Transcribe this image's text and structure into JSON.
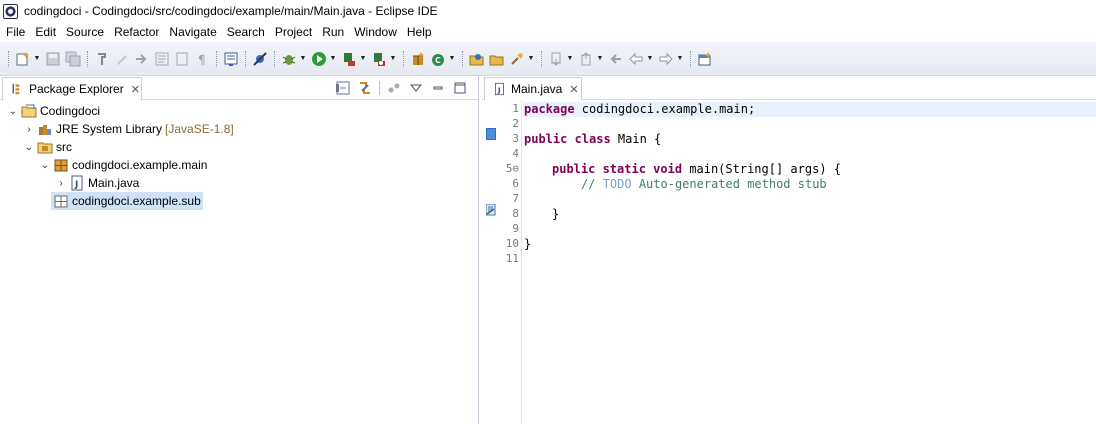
{
  "window": {
    "title": "codingdoci - Codingdoci/src/codingdoci/example/main/Main.java - Eclipse IDE"
  },
  "menu": [
    "File",
    "Edit",
    "Source",
    "Refactor",
    "Navigate",
    "Search",
    "Project",
    "Run",
    "Window",
    "Help"
  ],
  "package_explorer": {
    "tab_label": "Package Explorer",
    "tab_close": "✕",
    "tree": {
      "project": "Codingdoci",
      "jre": "JRE System Library",
      "jre_decor": "[JavaSE-1.8]",
      "src": "src",
      "pkg_main": "codingdoci.example.main",
      "file_main": "Main.java",
      "pkg_sub": "codingdoci.example.sub"
    }
  },
  "editor": {
    "tab_label": "Main.java",
    "tab_close": "✕",
    "line_numbers": [
      "1",
      "2",
      "3",
      "4",
      "5⊖",
      "6",
      "7",
      "8",
      "9",
      "10",
      "11"
    ],
    "code": {
      "l1_kw": "package",
      "l1_rest": " codingdoci.example.main;",
      "l3_kw": "public class",
      "l3_rest": " Main {",
      "l5_kw": "public static void",
      "l5_rest": " main(String[] args) {",
      "l6_comment_start": "// ",
      "l6_todo": "TODO",
      "l6_comment_end": " Auto-generated method stub",
      "l8": "}",
      "l10": "}"
    }
  },
  "colors": {
    "keyword": "#7f0055",
    "comment": "#3f7f5f",
    "todo": "#7f9fbf",
    "current_line": "#e8f2fe",
    "selection": "#cfe2f7"
  }
}
